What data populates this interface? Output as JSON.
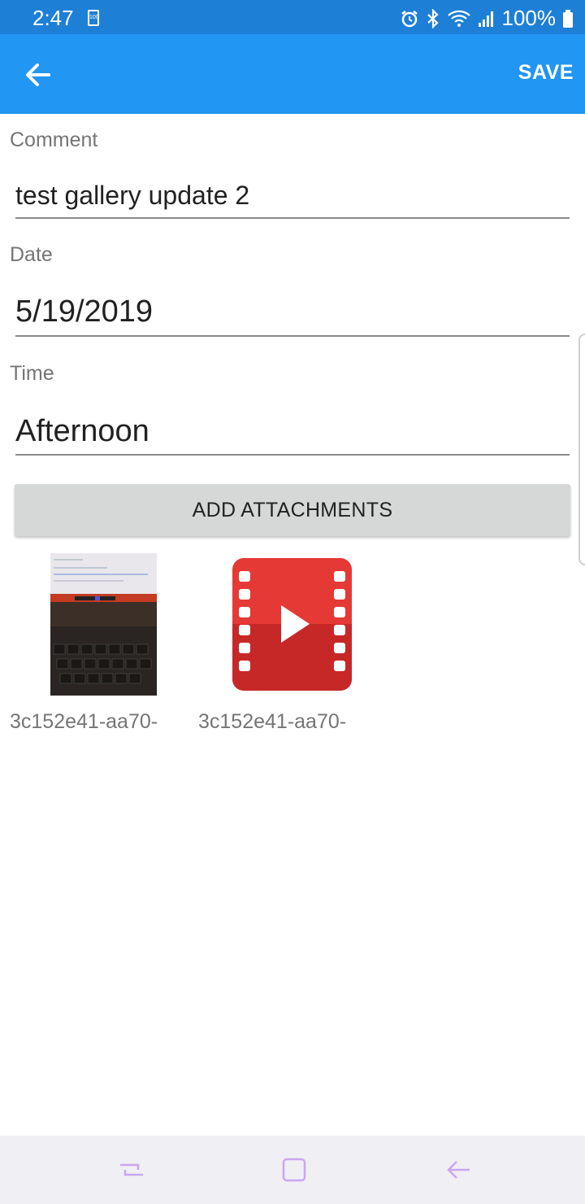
{
  "status_bar": {
    "time": "2:47",
    "battery_small_label": "100",
    "battery_percent": "100%",
    "icons": [
      "alarm-icon",
      "bluetooth-icon",
      "wifi-icon",
      "signal-icon",
      "battery-icon"
    ]
  },
  "app_bar": {
    "back_icon": "arrow-back-icon",
    "save_label": "SAVE",
    "color": "#2196f3"
  },
  "form": {
    "comment": {
      "label": "Comment",
      "value": "test gallery update 2"
    },
    "date": {
      "label": "Date",
      "value": "5/19/2019"
    },
    "time": {
      "label": "Time",
      "value": "Afternoon"
    }
  },
  "add_attachments_label": "ADD ATTACHMENTS",
  "attachments": [
    {
      "type": "image",
      "caption": "3c152e41-aa70-"
    },
    {
      "type": "video",
      "caption": "3c152e41-aa70-"
    }
  ],
  "nav_bar": {
    "icons": [
      "recent-apps-icon",
      "home-icon",
      "back-icon"
    ],
    "icon_color": "#c9a6f0"
  }
}
